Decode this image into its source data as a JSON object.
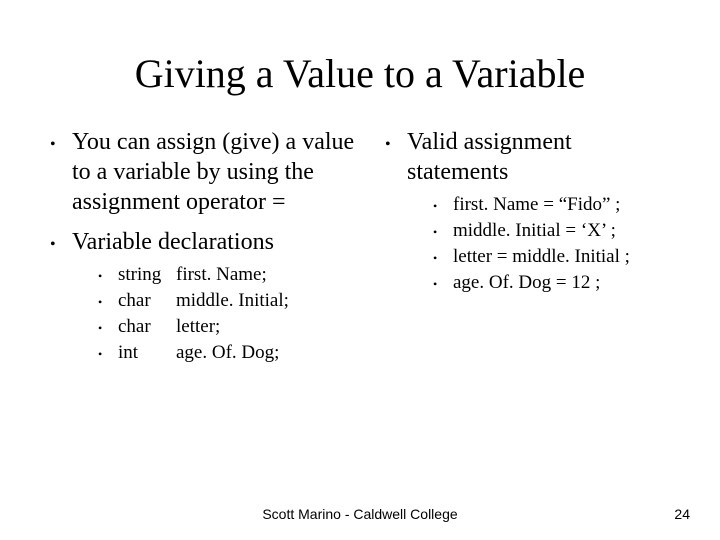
{
  "title": "Giving a Value to a Variable",
  "left": {
    "items": [
      {
        "text": "You can assign (give) a value to a variable by using the assignment operator ="
      },
      {
        "text": "Variable declarations",
        "sub": [
          {
            "type": "string",
            "name": "first. Name;"
          },
          {
            "type": "char",
            "name": "middle. Initial;"
          },
          {
            "type": "char",
            "name": "letter;"
          },
          {
            "type": "int",
            "name": "age. Of. Dog;"
          }
        ]
      }
    ]
  },
  "right": {
    "items": [
      {
        "text": "Valid assignment statements",
        "sub": [
          {
            "text": "first. Name = “Fido” ;"
          },
          {
            "text": "middle. Initial = ‘X’ ;"
          },
          {
            "text": "letter = middle. Initial ;"
          },
          {
            "text": "age. Of. Dog = 12 ;"
          }
        ]
      }
    ]
  },
  "footer": "Scott Marino - Caldwell College",
  "page": "24"
}
